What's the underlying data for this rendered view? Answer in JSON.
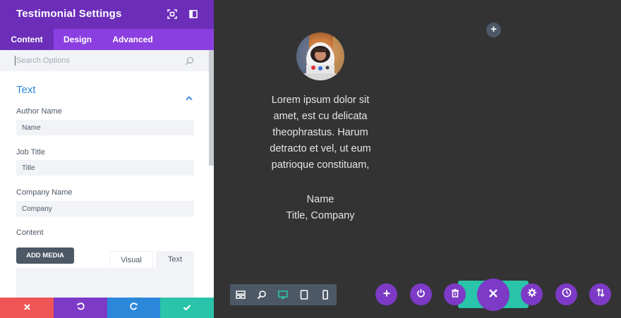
{
  "panel": {
    "title": "Testimonial Settings",
    "header_icons": [
      "expand-icon",
      "sidebar-toggle-icon"
    ],
    "tabs": [
      {
        "label": "Content",
        "active": true
      },
      {
        "label": "Design",
        "active": false
      },
      {
        "label": "Advanced",
        "active": false
      }
    ],
    "search": {
      "placeholder": "Search Options"
    },
    "section": {
      "title": "Text",
      "expanded": true
    },
    "fields": {
      "author_name": {
        "label": "Author Name",
        "value": "Name"
      },
      "job_title": {
        "label": "Job Title",
        "value": "Title"
      },
      "company_name": {
        "label": "Company Name",
        "value": "Company"
      },
      "content": {
        "label": "Content"
      }
    },
    "editor": {
      "add_media_label": "ADD MEDIA",
      "tabs": [
        {
          "label": "Visual",
          "active": true
        },
        {
          "label": "Text",
          "active": false
        }
      ]
    },
    "footer_buttons": [
      {
        "name": "discard",
        "icon": "close-icon",
        "color": "#ef5555"
      },
      {
        "name": "undo",
        "icon": "undo-icon",
        "color": "#7c3ac6"
      },
      {
        "name": "redo",
        "icon": "redo-icon",
        "color": "#2b87da"
      },
      {
        "name": "save",
        "icon": "check-icon",
        "color": "#29c4a9"
      }
    ]
  },
  "canvas": {
    "quote_lines": [
      "Lorem ipsum dolor sit",
      "amet, est cu delicata",
      "theophrastus. Harum",
      "detracto et vel, ut eum",
      "patrioque constituam,"
    ],
    "author": "Name",
    "job_company": "Title, Company"
  },
  "bottom_bar": {
    "view_modes": [
      "wireframe-icon",
      "zoom-icon",
      "desktop-icon",
      "tablet-icon",
      "phone-icon"
    ],
    "active_view": "desktop-icon",
    "page_actions": [
      "add-icon",
      "power-icon",
      "trash-icon",
      "close-icon",
      "gear-icon",
      "history-icon",
      "sort-icon"
    ]
  },
  "colors": {
    "header_purple": "#6c2eb9",
    "tab_purple": "#8b3fe0",
    "accent_blue": "#2b87da",
    "canvas_bg": "#333333",
    "action_purple": "#7c3ac6",
    "teal": "#29c4a9",
    "red": "#ef5555"
  }
}
